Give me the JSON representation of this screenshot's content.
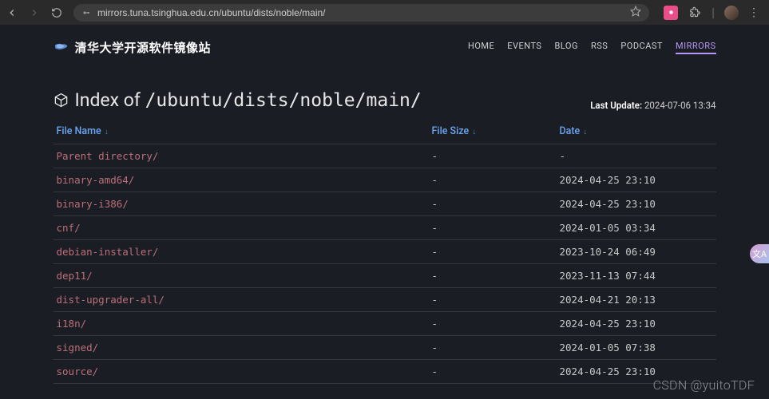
{
  "browser": {
    "url": "mirrors.tuna.tsinghua.edu.cn/ubuntu/dists/noble/main/"
  },
  "brand": {
    "title": "清华大学开源软件镜像站"
  },
  "nav": {
    "items": [
      {
        "label": "HOME"
      },
      {
        "label": "EVENTS"
      },
      {
        "label": "BLOG"
      },
      {
        "label": "RSS"
      },
      {
        "label": "PODCAST"
      },
      {
        "label": "MIRRORS",
        "active": true
      }
    ]
  },
  "index": {
    "prefix": "Index of ",
    "path": "/ubuntu/dists/noble/main/",
    "last_update_label": "Last Update:",
    "last_update_value": "2024-07-06 13:34"
  },
  "columns": {
    "name": "File Name",
    "size": "File Size",
    "date": "Date"
  },
  "rows": [
    {
      "name": "Parent directory/",
      "size": "-",
      "date": "-"
    },
    {
      "name": "binary-amd64/",
      "size": "-",
      "date": "2024-04-25 23:10"
    },
    {
      "name": "binary-i386/",
      "size": "-",
      "date": "2024-04-25 23:10"
    },
    {
      "name": "cnf/",
      "size": "-",
      "date": "2024-01-05 03:34"
    },
    {
      "name": "debian-installer/",
      "size": "-",
      "date": "2023-10-24 06:49"
    },
    {
      "name": "dep11/",
      "size": "-",
      "date": "2023-11-13 07:44"
    },
    {
      "name": "dist-upgrader-all/",
      "size": "-",
      "date": "2024-04-21 20:13"
    },
    {
      "name": "i18n/",
      "size": "-",
      "date": "2024-04-25 23:10"
    },
    {
      "name": "signed/",
      "size": "-",
      "date": "2024-01-05 07:38"
    },
    {
      "name": "source/",
      "size": "-",
      "date": "2024-04-25 23:10"
    }
  ],
  "watermark": "CSDN @yuitoTDF"
}
